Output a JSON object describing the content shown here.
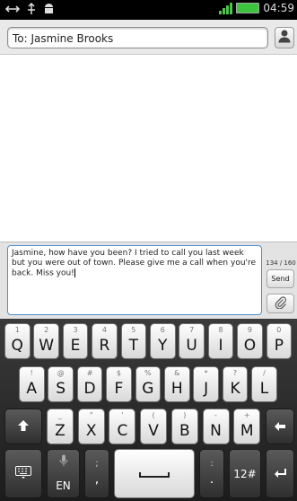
{
  "status_bar": {
    "time": "04:59",
    "left_icons": [
      "usb-icon",
      "debug-icon",
      "android-icon"
    ],
    "right_icons": [
      "signal-icon",
      "battery-icon"
    ]
  },
  "recipient": {
    "field_value": "To: Jasmine Brooks",
    "contact_icon": "person-icon"
  },
  "compose": {
    "message": "Jasmine, how have you been? I tried to call you last week but you were out of town. Please give me a call when you're back. Miss you!",
    "char_count": "134 / 160",
    "send_label": "Send",
    "attach_icon": "paperclip-icon"
  },
  "keyboard": {
    "row1": [
      {
        "sub": "1",
        "main": "Q"
      },
      {
        "sub": "2",
        "main": "W"
      },
      {
        "sub": "3",
        "main": "E"
      },
      {
        "sub": "4",
        "main": "R"
      },
      {
        "sub": "5",
        "main": "T"
      },
      {
        "sub": "6",
        "main": "Y"
      },
      {
        "sub": "7",
        "main": "U"
      },
      {
        "sub": "8",
        "main": "I"
      },
      {
        "sub": "9",
        "main": "O"
      },
      {
        "sub": "0",
        "main": "P"
      }
    ],
    "row2": [
      {
        "sub": "!",
        "main": "A"
      },
      {
        "sub": "@",
        "main": "S"
      },
      {
        "sub": "#",
        "main": "D"
      },
      {
        "sub": "$",
        "main": "F"
      },
      {
        "sub": "%",
        "main": "G"
      },
      {
        "sub": "&",
        "main": "H"
      },
      {
        "sub": "*",
        "main": "J"
      },
      {
        "sub": "?",
        "main": "K"
      },
      {
        "sub": "/",
        "main": "L"
      }
    ],
    "row3": [
      {
        "sub": "_",
        "main": "Z"
      },
      {
        "sub": "\"",
        "main": "X"
      },
      {
        "sub": "'",
        "main": "C"
      },
      {
        "sub": "(",
        "main": "V"
      },
      {
        "sub": ")",
        "main": "B"
      },
      {
        "sub": "-",
        "main": "N"
      },
      {
        "sub": "+",
        "main": "M"
      }
    ],
    "shift_icon": "shift-arrow-icon",
    "backspace_icon": "backspace-arrow-icon",
    "bottom": {
      "keyboard_settings_icon": "keyboard-icon",
      "mic_icon": "microphone-icon",
      "lang_label": "EN",
      "comma_sub": ";",
      "comma_main": ",",
      "space_icon": "space-icon",
      "period_sub": ":",
      "period_main": ".",
      "symbols_label": "12#",
      "enter_icon": "enter-arrow-icon"
    }
  }
}
